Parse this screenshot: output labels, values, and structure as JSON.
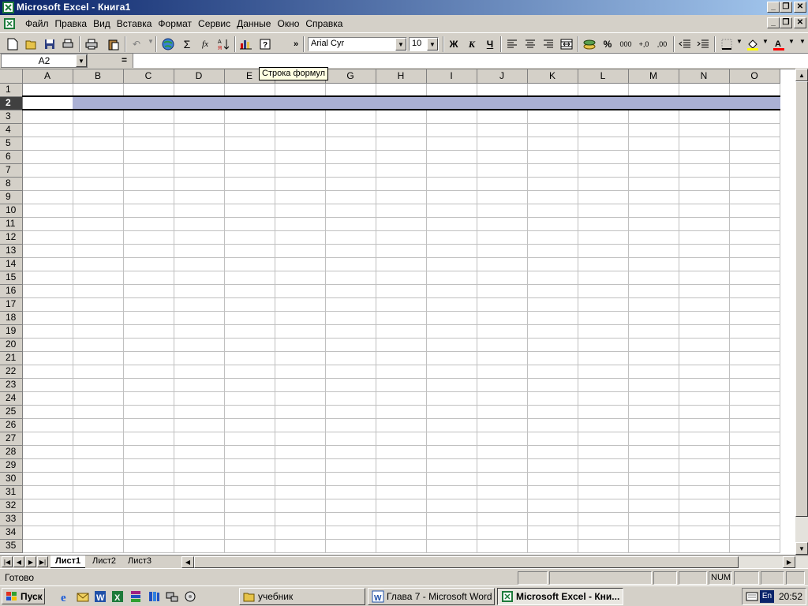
{
  "window": {
    "title": "Microsoft Excel - Книга1"
  },
  "menu": {
    "items": [
      "Файл",
      "Правка",
      "Вид",
      "Вставка",
      "Формат",
      "Сервис",
      "Данные",
      "Окно",
      "Справка"
    ]
  },
  "toolbar": {
    "font_name": "Arial Cyr",
    "font_size": "10",
    "bold_label": "Ж",
    "italic_label": "К",
    "underline_label": "Ч",
    "sum_label": "Σ",
    "fx_label": "fx",
    "percent_label": "%",
    "thousands_label": "000",
    "inc_decimal_label": "+,0",
    "dec_decimal_label": ",00",
    "more_label": "»"
  },
  "formula_bar": {
    "name_box": "A2",
    "equals": "=",
    "value": ""
  },
  "tooltip": {
    "text": "Строка формул"
  },
  "grid": {
    "columns": [
      "A",
      "B",
      "C",
      "D",
      "E",
      "F",
      "G",
      "H",
      "I",
      "J",
      "K",
      "L",
      "M",
      "N",
      "O"
    ],
    "rows": [
      "1",
      "2",
      "3",
      "4",
      "5",
      "6",
      "7",
      "8",
      "9",
      "10",
      "11",
      "12",
      "13",
      "14",
      "15",
      "16",
      "17",
      "18",
      "19",
      "20",
      "21",
      "22",
      "23",
      "24",
      "25",
      "26",
      "27",
      "28",
      "29",
      "30",
      "31",
      "32",
      "33",
      "34",
      "35"
    ],
    "selected_row": "2",
    "active_cell": "A2"
  },
  "sheets": {
    "tabs": [
      "Лист1",
      "Лист2",
      "Лист3"
    ],
    "active": "Лист1"
  },
  "status": {
    "text": "Готово",
    "num": "NUM"
  },
  "taskbar": {
    "start_label": "Пуск",
    "buttons": [
      "учебник",
      "Глава 7 - Microsoft Word",
      "Microsoft Excel - Кни..."
    ],
    "lang": "En",
    "clock": "20:52"
  }
}
